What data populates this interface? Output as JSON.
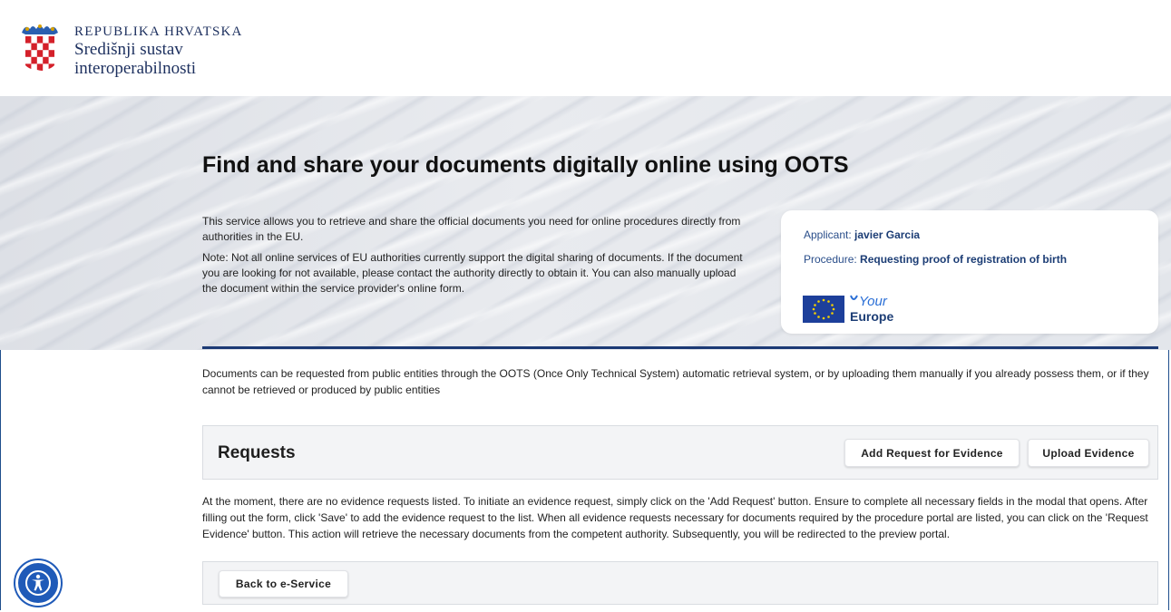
{
  "header": {
    "country": "REPUBLIKA HRVATSKA",
    "system_line1": "Središnji sustav",
    "system_line2": "interoperabilnosti"
  },
  "hero": {
    "title": "Find and share your documents digitally online using OOTS",
    "paragraph1": "This service allows you to retrieve and share the official documents you need for online procedures directly from authorities in the EU.",
    "paragraph2": "Note: Not all online services of EU authorities currently support the digital sharing of documents. If the document you are looking for not available, please contact the authority directly to obtain it. You can also manually upload the document within the service provider's online form."
  },
  "info_card": {
    "applicant_label": "Applicant:",
    "applicant_value": "javier Garcia",
    "procedure_label": "Procedure:",
    "procedure_value": "Requesting proof of registration of birth",
    "logo_your": "Your",
    "logo_europe": "Europe"
  },
  "intro_text": "Documents can be requested from public entities through the OOTS (Once Only Technical System) automatic retrieval system, or by uploading them manually if you already possess them, or if they cannot be retrieved or produced by public entities",
  "requests": {
    "title": "Requests",
    "add_button": "Add Request for Evidence",
    "upload_button": "Upload Evidence",
    "empty_text": "At the moment, there are no evidence requests listed. To initiate an evidence request, simply click on the 'Add Request' button. Ensure to complete all necessary fields in the modal that opens. After filling out the form, click 'Save' to add the evidence request to the list. When all evidence requests necessary for documents required by the procedure portal are listed, you can click on the 'Request Evidence' button. This action will retrieve the necessary documents from the competent authority. Subsequently, you will be redirected to the preview portal."
  },
  "back_button": "Back to e-Service",
  "icons": {
    "coat_of_arms": "croatian-coat-of-arms-icon",
    "eu_flag": "eu-flag-icon",
    "accessibility": "accessibility-icon"
  },
  "colors": {
    "brand_navy": "#1c2f5e",
    "link_blue": "#2a4e8a",
    "accent_line": "#1c3a75",
    "accessibility_blue": "#1f5ab8"
  }
}
